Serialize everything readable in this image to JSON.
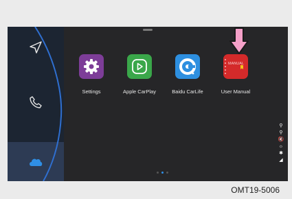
{
  "apps": [
    {
      "label": "Settings",
      "icon": "gear-icon",
      "color": "#7d3d98"
    },
    {
      "label": "Apple CarPlay",
      "icon": "carplay-play-icon",
      "color": "#3aa74a"
    },
    {
      "label": "Baidu CarLife",
      "icon": "carlife-icon",
      "color": "#2d8fe0"
    },
    {
      "label": "User Manual",
      "icon": "manual-book-icon",
      "color": "#d42a2a"
    }
  ],
  "manual_tile_text": "MANUAL",
  "sidebar": {
    "items": [
      {
        "icon": "navigation-arrow-icon"
      },
      {
        "icon": "phone-icon"
      },
      {
        "icon": "cloud-icon",
        "active": true
      }
    ]
  },
  "status_icons": [
    "usb-icon",
    "usb-icon",
    "mute-icon",
    "wifi-icon",
    "bluetooth-icon",
    "signal-icon"
  ],
  "pages": {
    "count": 3,
    "active": 1
  },
  "caption": "OMT19-5006"
}
